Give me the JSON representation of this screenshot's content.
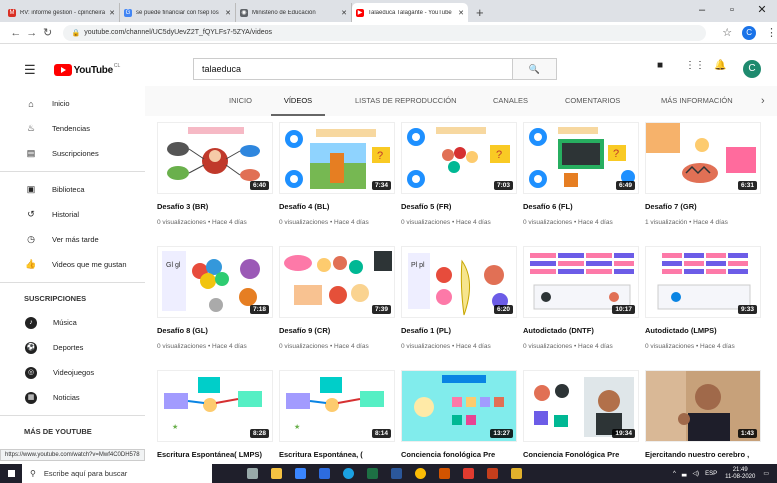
{
  "tabs": [
    {
      "label": "RV: informe gestion - cpincheira",
      "favicon_color": "#d93025",
      "favicon": "M"
    },
    {
      "label": "se puede financiar con fsep los",
      "favicon_color": "#4285f4",
      "favicon": "G"
    },
    {
      "label": "Ministerio de Educación",
      "favicon_color": "#5f6368",
      "favicon": "◉"
    },
    {
      "label": "Talaeduca Talagante - YouTube",
      "favicon_color": "#ff0000",
      "favicon": "▶"
    }
  ],
  "new_tab": "+",
  "url": "youtube.com/channel/UC5dyUevZ2T_fQYLFs7-5ZYA/videos",
  "brand_logo": "YouTube",
  "brand_country": "CL",
  "search": {
    "value": "talaeduca"
  },
  "user_initial": "C",
  "sidebar": {
    "primary": [
      {
        "label": "Inicio",
        "icon": "home-icon",
        "glyph": "⌂"
      },
      {
        "label": "Tendencias",
        "icon": "flame-icon",
        "glyph": "♨"
      },
      {
        "label": "Suscripciones",
        "icon": "subscriptions-icon",
        "glyph": "▤"
      }
    ],
    "library": [
      {
        "label": "Biblioteca",
        "icon": "library-icon",
        "glyph": "▣"
      },
      {
        "label": "Historial",
        "icon": "history-icon",
        "glyph": "↺"
      },
      {
        "label": "Ver más tarde",
        "icon": "clock-icon",
        "glyph": "◷"
      },
      {
        "label": "Videos que me gustan",
        "icon": "thumbs-up-icon",
        "glyph": "👍"
      }
    ],
    "subscriptions_heading": "SUSCRIPCIONES",
    "subscriptions": [
      {
        "label": "Música",
        "glyph": "♪"
      },
      {
        "label": "Deportes",
        "glyph": "⚽"
      },
      {
        "label": "Videojuegos",
        "glyph": "◎"
      },
      {
        "label": "Noticias",
        "glyph": "▦"
      }
    ],
    "more_heading": "MÁS DE YOUTUBE"
  },
  "channel_tabs": [
    "INICIO",
    "VÍDEOS",
    "LISTAS DE REPRODUCCIÓN",
    "CANALES",
    "COMENTARIOS",
    "MÁS INFORMACIÓN"
  ],
  "channel_tab_next": "›",
  "videos": [
    {
      "title": "Desafío 3 (BR)",
      "meta": "0 visualizaciones • Hace 4 días",
      "duration": "6:40"
    },
    {
      "title": "Desafío 4 (BL)",
      "meta": "0 visualizaciones • Hace 4 días",
      "duration": "7:34"
    },
    {
      "title": "Desafío 5 (FR)",
      "meta": "0 visualizaciones • Hace 4 días",
      "duration": "7:03"
    },
    {
      "title": "Desafío 6 (FL)",
      "meta": "0 visualizaciones • Hace 4 días",
      "duration": "6:49"
    },
    {
      "title": "Desafío 7 (GR)",
      "meta": "1 visualización • Hace 4 días",
      "duration": "6:31"
    },
    {
      "title": "Desafío 8 (GL)",
      "meta": "0 visualizaciones • Hace 4 días",
      "duration": "7:18"
    },
    {
      "title": "Desafío 9 (CR)",
      "meta": "0 visualizaciones • Hace 4 días",
      "duration": "7:39"
    },
    {
      "title": "Desafío 1 (PL)",
      "meta": "0 visualizaciones • Hace 4 días",
      "duration": "6:20"
    },
    {
      "title": "Autodictado (DNTF)",
      "meta": "0 visualizaciones • Hace 4 días",
      "duration": "10:17"
    },
    {
      "title": "Autodictado (LMPS)",
      "meta": "0 visualizaciones • Hace 4 días",
      "duration": "9:33"
    },
    {
      "title": "Escritura Espontánea( LMPS)",
      "meta": "",
      "duration": "8:28"
    },
    {
      "title": "Escritura Espontánea, (",
      "meta": "",
      "duration": "8:14"
    },
    {
      "title": "Conciencia fonológica Pre",
      "meta": "",
      "duration": "13:27"
    },
    {
      "title": "Conciencia Fonológica Pre",
      "meta": "",
      "duration": "19:34"
    },
    {
      "title": "Ejercitando nuestro cerebro ,",
      "meta": "",
      "duration": "1:43"
    }
  ],
  "status_url": "https://www.youtube.com/watch?v=Mwf4C0DH578",
  "taskbar": {
    "search_placeholder": "Escribe aquí para buscar",
    "lang": "ESP",
    "time": "21:49",
    "date": "11-08-2020"
  },
  "colors": {
    "accent": "#ff0000",
    "duration_bg": "#000000"
  }
}
